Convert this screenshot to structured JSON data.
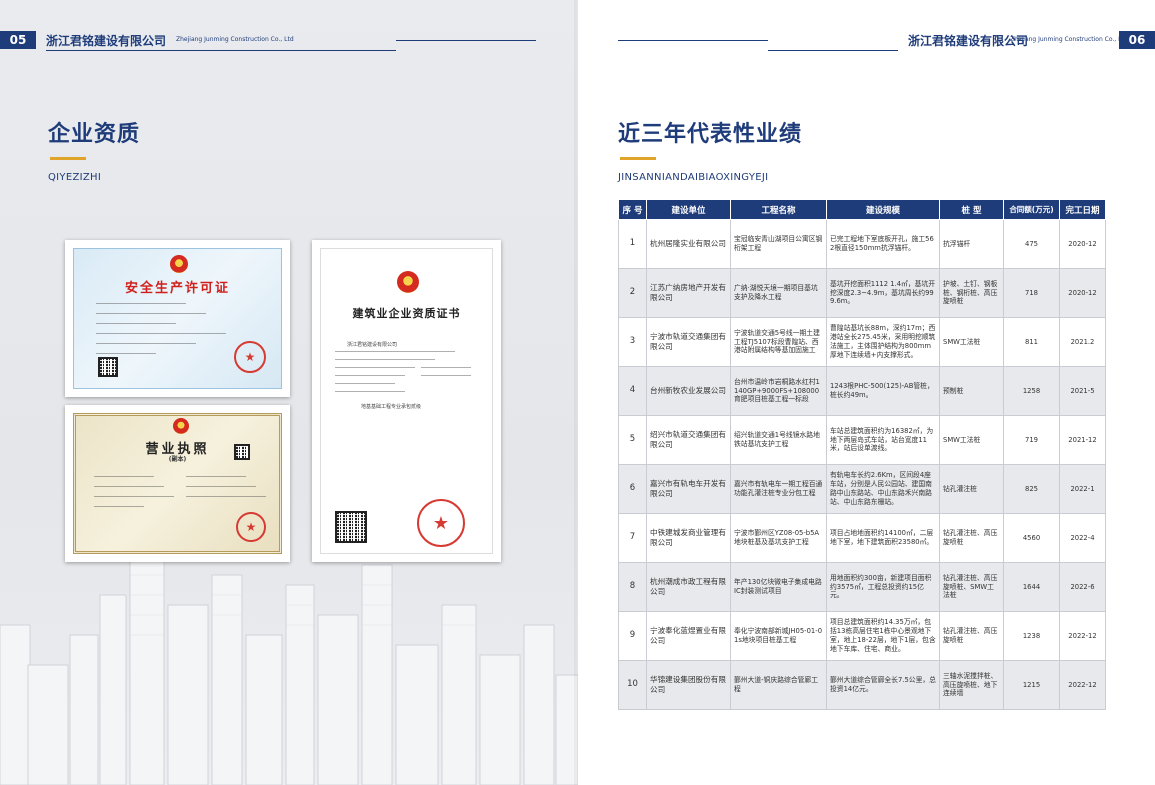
{
  "left_page": {
    "page_number": "05",
    "company_cn": "浙江君铭建设有限公司",
    "company_en": "Zhejiang Junming Construction Co., Ltd",
    "section_title": "企业资质",
    "section_pinyin": "QIYEZIZHI",
    "certificates": {
      "safety_title": "安全生产许可证",
      "license_title": "营业执照",
      "license_subtitle": "(副本)",
      "qualification_title": "建筑业企业资质证书",
      "qualification_field_1": "浙江君铭建设有限公司",
      "qualification_field_2": "地基基础工程专业承包贰级"
    }
  },
  "right_page": {
    "page_number": "06",
    "company_cn": "浙江君铭建设有限公司",
    "company_en": "Zhejiang Junming Construction Co., Ltd",
    "section_title": "近三年代表性业绩",
    "section_pinyin": "JINSANNIANDAIBIAOXINGYEJI",
    "table": {
      "headers": [
        "序 号",
        "建设单位",
        "工程名称",
        "建设规模",
        "桩 型",
        "合同额(万元)",
        "完工日期"
      ],
      "rows": [
        {
          "no": "1",
          "unit": "杭州居隆实业有限公司",
          "project": "宝冠临安青山湖项目公寓区钢桁架工程",
          "scale": "已完工程地下室底板开孔，施工562根直径150mm抗浮锚杆。",
          "pile": "抗浮锚杆",
          "amount": "475",
          "date": "2020-12"
        },
        {
          "no": "2",
          "unit": "江苏广纳房地产开发有限公司",
          "project": "广纳·湖悦天境一期项目基坑支护及降水工程",
          "scale": "基坑开挖面积1112 1.4㎡，基坑开挖深度2.3~4.9m，基坑周长约999.6m。",
          "pile": "护坡、土钉、钢板桩、钢桁桩、高压旋喷桩",
          "amount": "718",
          "date": "2020-12"
        },
        {
          "no": "3",
          "unit": "宁波市轨道交通集团有限公司",
          "project": "宁波轨道交通5号线一期土建工程TJ5107标段曹隍站、西港站附属结构等基加固施工",
          "scale": "曹隍站基坑长88m，深约17m；西港站全长275.45米，采用明挖顺筑法施工，主体围护结构为800mm厚地下连续墙+内支撑形式。",
          "pile": "SMW工法桩",
          "amount": "811",
          "date": "2021.2"
        },
        {
          "no": "4",
          "unit": "台州新牧农业发展公司",
          "project": "台州市温岭市岩桐路水红村1140GP+9000FS+108000育肥项目桩基工程一标段",
          "scale": "1243根PHC-500(125)-AB管桩，桩长约49m。",
          "pile": "预制桩",
          "amount": "1258",
          "date": "2021-5"
        },
        {
          "no": "5",
          "unit": "绍兴市轨道交通集团有限公司",
          "project": "绍兴轨道交通1号线镜水路地铁站基坑支护工程",
          "scale": "车站总建筑面积约为16382㎡，为地下两层岛式车站，站台宽度11米，站后设单渡线。",
          "pile": "SMW工法桩",
          "amount": "719",
          "date": "2021-12"
        },
        {
          "no": "6",
          "unit": "嘉兴市有轨电车开发有限公司",
          "project": "嘉兴市有轨电车一期工程百通功能孔灌注桩专业分包工程",
          "scale": "有轨电车长约2.6Km，区间段4座车站，分别是人民公园站、建国南路中山东路站、中山东路禾兴南路站、中山东路东栅站。",
          "pile": "钻孔灌注桩",
          "amount": "825",
          "date": "2022-1"
        },
        {
          "no": "7",
          "unit": "中铁建城发商业管理有限公司",
          "project": "宁波市鄞州区YZ08-05-b5A地块桩基及基坑支护工程",
          "scale": "项目占地地面积约14100㎡，二层地下室，地下建筑面积23580㎡。",
          "pile": "钻孔灌注桩、高压旋喷桩",
          "amount": "4560",
          "date": "2022-4"
        },
        {
          "no": "8",
          "unit": "杭州潮成市政工程有限公司",
          "project": "年产130亿块微电子集成电路IC封装测试项目",
          "scale": "用地面积约300亩，新建项目面积约3575㎡，工程总投资约15亿元。",
          "pile": "钻孔灌注桩、高压旋喷桩、SMW工法桩",
          "amount": "1644",
          "date": "2022-6"
        },
        {
          "no": "9",
          "unit": "宁波奉化蓝煜置业有限公司",
          "project": "奉化宁波南部新城JH05-01-01s地块项目桩基工程",
          "scale": "项目总建筑面积约14.35万㎡，包括13栋高层住宅1栋中心景观地下室，地上18-22层，地下1层，包含地下车库、住宅、商业。",
          "pile": "钻孔灌注桩、高压旋喷桩",
          "amount": "1238",
          "date": "2022-12"
        },
        {
          "no": "10",
          "unit": "华锦建设集团股份有限公司",
          "project": "鄞州大道-铜庆路综合管廊工程",
          "scale": "鄞州大道综合管廊全长7.5公里，总投资14亿元。",
          "pile": "三轴水泥搅拌桩、高压旋喷桩、地下连续墙",
          "amount": "1215",
          "date": "2022-12"
        }
      ]
    }
  },
  "colors": {
    "brand_blue": "#1f3c7a",
    "accent_gold": "#e0a42a",
    "seal_red": "#d63a32"
  }
}
